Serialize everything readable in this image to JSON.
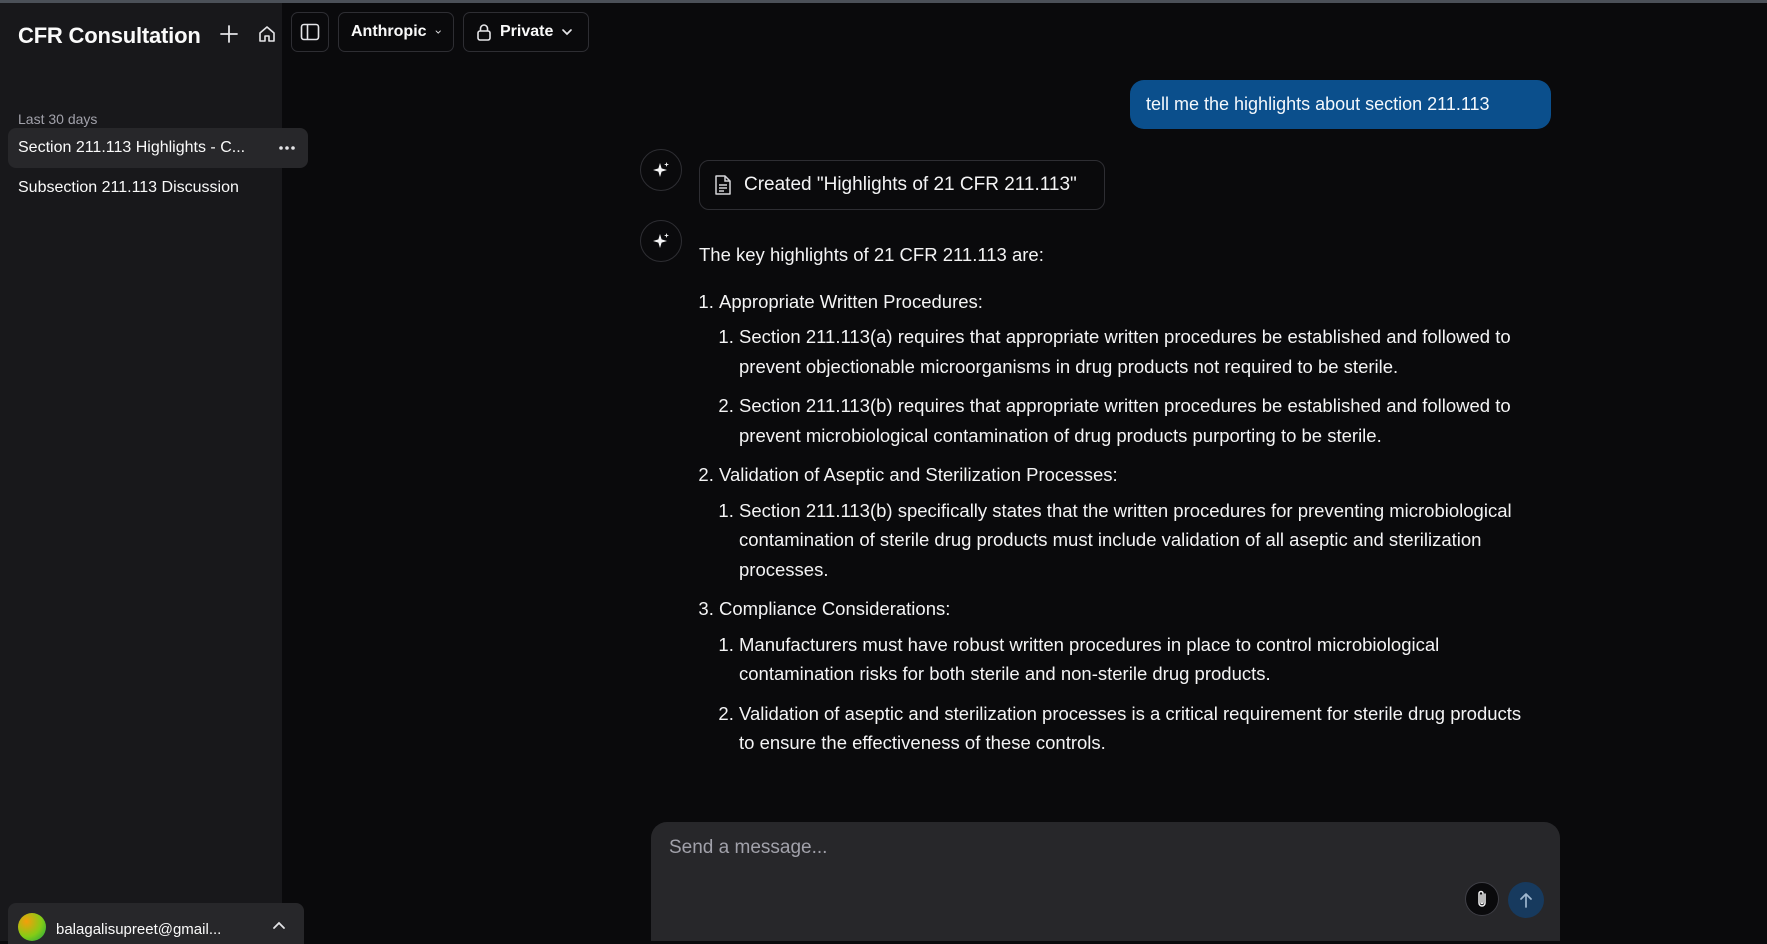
{
  "sidebar": {
    "app_title": "CFR Consultation",
    "new_chat_icon": "plus-icon",
    "home_icon": "home-icon",
    "section_label": "Last 30 days",
    "items": [
      {
        "label": "Section 211.113 Highlights - C...",
        "active": true
      },
      {
        "label": "Subsection 211.113 Discussion",
        "active": false
      }
    ],
    "user": {
      "email": "balagalisupreet@gmail..."
    }
  },
  "header": {
    "toggle_sidebar_icon": "sidebar-toggle-icon",
    "model_label": "Anthropic",
    "visibility_label": "Private"
  },
  "chat": {
    "user_message": "tell me the highlights about section 211.113",
    "tool_result": "Created \"Highlights of 21 CFR 211.113\"",
    "answer": {
      "intro": "The key highlights of 21 CFR 211.113 are:",
      "sections": [
        {
          "title": "Appropriate Written Procedures:",
          "items": [
            "Section 211.113(a) requires that appropriate written procedures be established and followed to prevent objectionable microorganisms in drug products not required to be sterile.",
            "Section 211.113(b) requires that appropriate written procedures be established and followed to prevent microbiological contamination of drug products purporting to be sterile."
          ]
        },
        {
          "title": "Validation of Aseptic and Sterilization Processes:",
          "items": [
            "Section 211.113(b) specifically states that the written procedures for preventing microbiological contamination of sterile drug products must include validation of all aseptic and sterilization processes."
          ]
        },
        {
          "title": "Compliance Considerations:",
          "items": [
            "Manufacturers must have robust written procedures in place to control microbiological contamination risks for both sterile and non-sterile drug products.",
            "Validation of aseptic and sterilization processes is a critical requirement for sterile drug products to ensure the effectiveness of these controls."
          ]
        }
      ]
    }
  },
  "composer": {
    "placeholder": "Send a message...",
    "attach_icon": "paperclip-icon",
    "send_icon": "arrow-up-icon"
  },
  "colors": {
    "user_bubble": "#0b4f8c",
    "sidebar_bg": "#18181b",
    "page_bg": "#0a0a0c",
    "composer_bg": "#27272a"
  }
}
